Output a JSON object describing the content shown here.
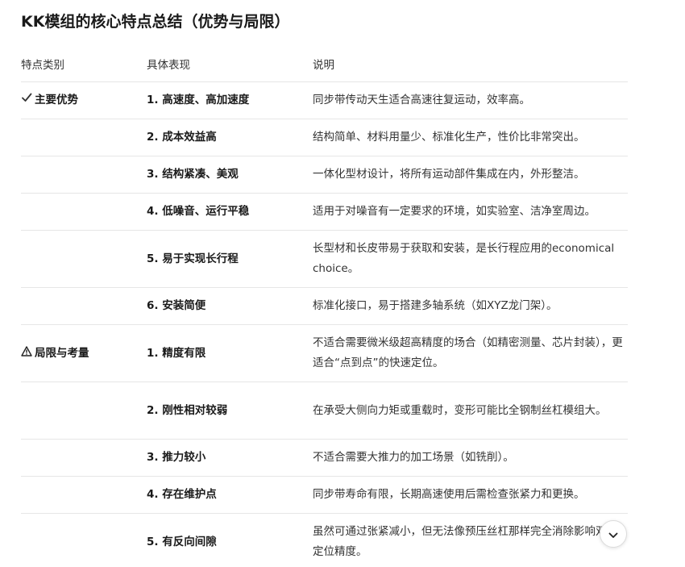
{
  "title": "KK模组的核心特点总结（优势与局限）",
  "table": {
    "headers": [
      "特点类别",
      "具体表现",
      "说明"
    ],
    "rows": [
      {
        "category": "主要优势",
        "category_icon": "check-icon",
        "item": "1. 高速度、高加速度",
        "desc": "同步带传动天生适合高速往复运动，效率高。"
      },
      {
        "category": "",
        "item": "2. 成本效益高",
        "desc": "结构简单、材料用量少、标准化生产，性价比非常突出。"
      },
      {
        "category": "",
        "item": "3. 结构紧凑、美观",
        "desc": "一体化型材设计，将所有运动部件集成在内，外形整洁。"
      },
      {
        "category": "",
        "item": "4. 低噪音、运行平稳",
        "desc": "适用于对噪音有一定要求的环境，如实验室、洁净室周边。"
      },
      {
        "category": "",
        "item": "5. 易于实现长行程",
        "desc": "长型材和长皮带易于获取和安装，是长行程应用的economical choice。"
      },
      {
        "category": "",
        "item": "6. 安装简便",
        "desc": "标准化接口，易于搭建多轴系统（如XYZ龙门架）。"
      },
      {
        "category": "局限与考量",
        "category_icon": "warning-icon",
        "item": "1. 精度有限",
        "desc": "不适合需要微米级超高精度的场合（如精密测量、芯片封装），更适合“点到点”的快速定位。"
      },
      {
        "category": "",
        "item": "2. 刚性相对较弱",
        "desc": "在承受大侧向力矩或重载时，变形可能比全钢制丝杠模组大。"
      },
      {
        "category": "",
        "item": "3. 推力较小",
        "desc": "不适合需要大推力的加工场景（如铣削）。"
      },
      {
        "category": "",
        "item": "4. 存在维护点",
        "desc": "同步带寿命有限，长期高速使用后需检查张紧力和更换。"
      },
      {
        "category": "",
        "item": "5. 有反向间隙",
        "desc": "虽然可通过张紧减小，但无法像预压丝杠那样完全消除影响双向定位精度。"
      }
    ]
  },
  "scroll_button": {
    "icon": "chevron-down-icon"
  }
}
